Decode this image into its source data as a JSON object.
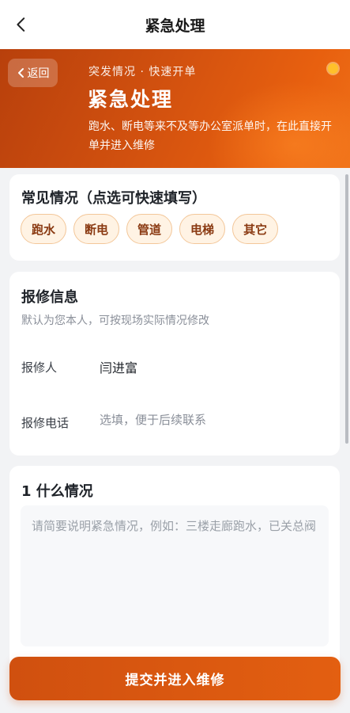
{
  "nav": {
    "title": "紧急处理",
    "back_icon": "chevron-left-icon"
  },
  "hero": {
    "back_label": "返回",
    "kicker": "突发情况 · 快速开单",
    "title": "紧急处理",
    "description": "跑水、断电等来不及等办公室派单时，在此直接开单并进入维修",
    "accent": "#d2510f",
    "dot_color": "#ffc02a"
  },
  "quick": {
    "heading": "常见情况（点选可快速填写）",
    "chips": [
      "跑水",
      "断电",
      "管道",
      "电梯",
      "其它"
    ]
  },
  "info": {
    "heading": "报修信息",
    "subtitle": "默认为您本人，可按现场实际情况修改",
    "reporter_label": "报修人",
    "reporter_value": "闫进富",
    "phone_label": "报修电话",
    "phone_placeholder": "选填，便于后续联系"
  },
  "what": {
    "heading": "1 什么情况",
    "placeholder": "请简要说明紧急情况，例如：三楼走廊跑水，已关总阀"
  },
  "submit_label": "提交并进入维修"
}
